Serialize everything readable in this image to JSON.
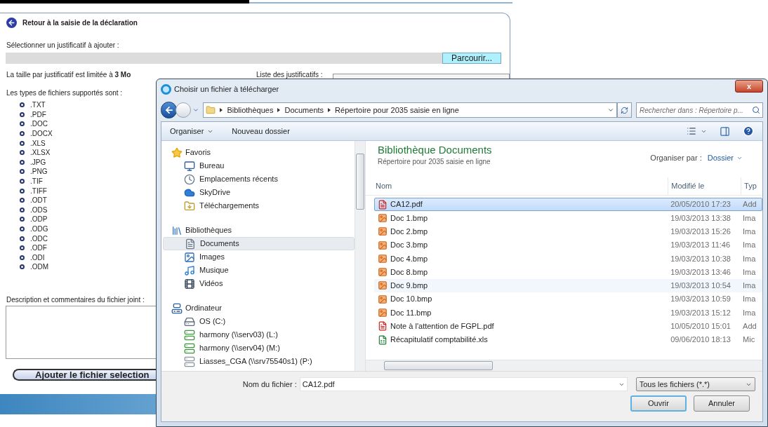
{
  "page": {
    "back_link": "Retour à la saisie de la déclaration",
    "select_label": "Sélectionner un justificatif à ajouter :",
    "browse_button": "Parcourir...",
    "size_note": "La taille par justificatif est limitée à **3 Mo**",
    "list_label": "Liste des justificatifs :",
    "types_label": "Les types de fichiers supportés sont :",
    "file_types": [
      ".TXT",
      ".PDF",
      ".DOC",
      ".DOCX",
      ".XLS",
      ".XLSX",
      ".JPG",
      ".PNG",
      ".TIF",
      ".TIFF",
      ".ODT",
      ".ODS",
      ".ODP",
      ".ODG",
      ".ODC",
      ".ODF",
      ".ODI",
      ".ODM"
    ],
    "description_label": "Description et commentaires du fichier joint :",
    "add_button": "Ajouter le fichier selection"
  },
  "dialog": {
    "title": "Choisir un fichier à télécharger",
    "close": "x",
    "breadcrumb": [
      "Bibliothèques",
      "Documents",
      "Répertoire pour 2035 saisie en ligne"
    ],
    "search": {
      "placeholder": "Rechercher dans : Répertoire p..."
    },
    "toolbar": {
      "organize": "Organiser",
      "new_folder": "Nouveau dossier"
    },
    "nav": [
      {
        "label": "Favoris",
        "kind": "star",
        "children": [
          {
            "label": "Bureau",
            "kind": "desktop",
            "selected": false
          },
          {
            "label": "Emplacements récents",
            "kind": "recent",
            "selected": false
          },
          {
            "label": "SkyDrive",
            "kind": "cloud",
            "selected": false
          },
          {
            "label": "Téléchargements",
            "kind": "download",
            "selected": false
          }
        ]
      },
      {
        "label": "Bibliothèques",
        "kind": "library",
        "children": [
          {
            "label": "Documents",
            "kind": "document",
            "selected": true
          },
          {
            "label": "Images",
            "kind": "image",
            "selected": false
          },
          {
            "label": "Musique",
            "kind": "music",
            "selected": false
          },
          {
            "label": "Vidéos",
            "kind": "video",
            "selected": false
          }
        ]
      },
      {
        "label": "Ordinateur",
        "kind": "computer",
        "children": [
          {
            "label": "OS (C:)",
            "kind": "disk",
            "selected": false
          },
          {
            "label": "harmony (\\\\serv03) (L:)",
            "kind": "network",
            "selected": false
          },
          {
            "label": "harmony (\\\\serv04) (M:)",
            "kind": "network",
            "selected": false
          },
          {
            "label": "Liasses_CGA (\\\\srv75540s1) (P:)",
            "kind": "network-off",
            "selected": false
          }
        ]
      }
    ],
    "library_title": "Bibliothèque Documents",
    "library_subtitle": "Répertoire pour 2035 saisie en ligne",
    "arrange_label": "Organiser par :",
    "arrange_value": "Dossier",
    "columns": [
      "Nom",
      "Modifié le",
      "Typ"
    ],
    "files": [
      {
        "name": "CA12.pdf",
        "kind": "pdf",
        "modified": "20/05/2010 17:23",
        "type": "Add",
        "selected": true,
        "hovered": false
      },
      {
        "name": "Doc 1.bmp",
        "kind": "bmp",
        "modified": "19/03/2013 13:38",
        "type": "Ima",
        "selected": false,
        "hovered": false
      },
      {
        "name": "Doc 2.bmp",
        "kind": "bmp",
        "modified": "19/03/2013 15:26",
        "type": "Ima",
        "selected": false,
        "hovered": false
      },
      {
        "name": "Doc 3.bmp",
        "kind": "bmp",
        "modified": "19/03/2013 11:46",
        "type": "Ima",
        "selected": false,
        "hovered": false
      },
      {
        "name": "Doc 4.bmp",
        "kind": "bmp",
        "modified": "19/03/2013 10:38",
        "type": "Ima",
        "selected": false,
        "hovered": false
      },
      {
        "name": "Doc 8.bmp",
        "kind": "bmp",
        "modified": "19/03/2013 13:46",
        "type": "Ima",
        "selected": false,
        "hovered": false
      },
      {
        "name": "Doc 9.bmp",
        "kind": "bmp",
        "modified": "19/03/2013 10:54",
        "type": "Ima",
        "selected": false,
        "hovered": true
      },
      {
        "name": "Doc 10.bmp",
        "kind": "bmp",
        "modified": "19/03/2013 10:59",
        "type": "Ima",
        "selected": false,
        "hovered": false
      },
      {
        "name": "Doc 11.bmp",
        "kind": "bmp",
        "modified": "19/03/2013 15:12",
        "type": "Ima",
        "selected": false,
        "hovered": false
      },
      {
        "name": "Note à l'attention de FGPL.pdf",
        "kind": "pdf",
        "modified": "10/05/2010 15:01",
        "type": "Add",
        "selected": false,
        "hovered": false
      },
      {
        "name": "Récapitulatif comptabilité.xls",
        "kind": "xls",
        "modified": "09/06/2010 18:13",
        "type": "Mic",
        "selected": false,
        "hovered": false
      }
    ],
    "filename_label": "Nom du fichier :",
    "filename_value": "CA12.pdf",
    "filter": "Tous les fichiers (*.*)",
    "buttons": [
      "Ouvrir",
      "Annuler"
    ]
  }
}
